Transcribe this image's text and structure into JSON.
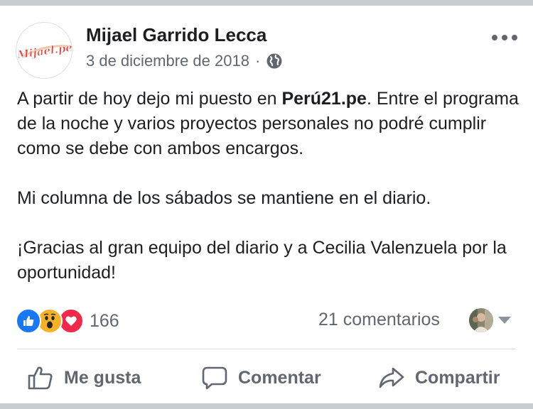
{
  "post": {
    "author": "Mijael Garrido Lecca",
    "date": "3 de diciembre de 2018",
    "separator": "·",
    "privacy_icon": "globe-icon",
    "avatar_logo_text": "Mijael.pe",
    "more_icon": "more-options-icon",
    "paragraph_1_pre": "A partir de hoy dejo mi puesto en ",
    "paragraph_1_bold": "Perú21.pe",
    "paragraph_1_post": ". Entre el programa de la noche y varios proyectos personales no podré cumplir como se debe con ambos encargos.",
    "paragraph_2": "Mi columna de los sábados se mantiene en el diario.",
    "paragraph_3": "¡Gracias al gran equipo del diario y a Cecilia Valenzuela por la oportunidad!"
  },
  "reactions": {
    "icons": [
      "like-reaction-icon",
      "wow-reaction-icon",
      "love-reaction-icon"
    ],
    "count": "166"
  },
  "comments": {
    "label": "21 comentarios"
  },
  "actions": {
    "like": "Me gusta",
    "comment": "Comentar",
    "share": "Compartir"
  },
  "colors": {
    "like_blue": "#1877f2",
    "wow_yellow": "#f7b125",
    "love_red": "#f0284a",
    "logo_red": "#e8413b",
    "secondary_text": "#606770"
  }
}
